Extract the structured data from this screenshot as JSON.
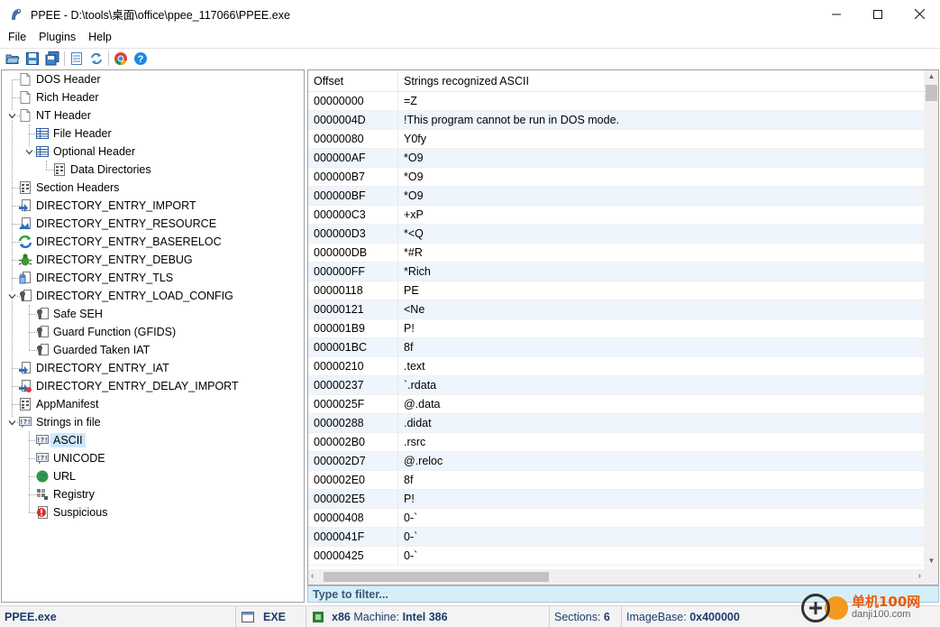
{
  "window": {
    "title": "PPEE - D:\\tools\\桌面\\office\\ppee_117066\\PPEE.exe",
    "minimize": "—",
    "maximize": "☐",
    "close": "✕"
  },
  "menu": [
    "File",
    "Plugins",
    "Help"
  ],
  "toolbar": {
    "buttons": [
      "open-folder",
      "save",
      "save-all",
      "properties",
      "refresh",
      "browser",
      "help"
    ]
  },
  "tree": [
    {
      "label": "DOS Header",
      "icon": "document-icon"
    },
    {
      "label": "Rich Header",
      "icon": "document-icon"
    },
    {
      "label": "NT Header",
      "icon": "document-icon"
    },
    {
      "label": "File Header",
      "icon": "table-icon"
    },
    {
      "label": "Optional Header",
      "icon": "table-icon"
    },
    {
      "label": "Data Directories",
      "icon": "grid-icon"
    },
    {
      "label": "Section Headers",
      "icon": "grid-icon"
    },
    {
      "label": "DIRECTORY_ENTRY_IMPORT",
      "icon": "import-icon"
    },
    {
      "label": "DIRECTORY_ENTRY_RESOURCE",
      "icon": "resource-icon"
    },
    {
      "label": "DIRECTORY_ENTRY_BASERELOC",
      "icon": "reloc-icon"
    },
    {
      "label": "DIRECTORY_ENTRY_DEBUG",
      "icon": "bug-icon"
    },
    {
      "label": "DIRECTORY_ENTRY_TLS",
      "icon": "tls-icon"
    },
    {
      "label": "DIRECTORY_ENTRY_LOAD_CONFIG",
      "icon": "config-icon"
    },
    {
      "label": "Safe SEH",
      "icon": "config-icon"
    },
    {
      "label": "Guard Function (GFIDS)",
      "icon": "config-icon"
    },
    {
      "label": "Guarded Taken IAT",
      "icon": "config-icon"
    },
    {
      "label": "DIRECTORY_ENTRY_IAT",
      "icon": "import-icon"
    },
    {
      "label": "DIRECTORY_ENTRY_DELAY_IMPORT",
      "icon": "delay-import-icon"
    },
    {
      "label": "AppManifest",
      "icon": "grid-icon"
    },
    {
      "label": "Strings in file",
      "icon": "strings-icon"
    },
    {
      "label": "ASCII",
      "icon": "strings-icon"
    },
    {
      "label": "UNICODE",
      "icon": "strings-icon"
    },
    {
      "label": "URL",
      "icon": "globe-icon"
    },
    {
      "label": "Registry",
      "icon": "registry-icon"
    },
    {
      "label": "Suspicious",
      "icon": "warning-icon"
    }
  ],
  "table": {
    "columns": [
      "Offset",
      "Strings recognized ASCII"
    ],
    "rows": [
      [
        "00000000",
        "=Z"
      ],
      [
        "0000004D",
        "!This program cannot be run in DOS mode."
      ],
      [
        "00000080",
        "Y0fy"
      ],
      [
        "000000AF",
        "*O9"
      ],
      [
        "000000B7",
        "*O9"
      ],
      [
        "000000BF",
        "*O9"
      ],
      [
        "000000C3",
        "+xP"
      ],
      [
        "000000D3",
        "*<Q"
      ],
      [
        "000000DB",
        "*#R"
      ],
      [
        "000000FF",
        "*Rich"
      ],
      [
        "00000118",
        "PE"
      ],
      [
        "00000121",
        "<Ne"
      ],
      [
        "000001B9",
        "P!"
      ],
      [
        "000001BC",
        "8f"
      ],
      [
        "00000210",
        ".text"
      ],
      [
        "00000237",
        "`.rdata"
      ],
      [
        "0000025F",
        "@.data"
      ],
      [
        "00000288",
        ".didat"
      ],
      [
        "000002B0",
        ".rsrc"
      ],
      [
        "000002D7",
        "@.reloc"
      ],
      [
        "000002E0",
        "8f"
      ],
      [
        "000002E5",
        "P!"
      ],
      [
        "00000408",
        "0-`"
      ],
      [
        "0000041F",
        "0-`"
      ],
      [
        "00000425",
        "0-`"
      ]
    ]
  },
  "filter": {
    "placeholder": "Type to filter..."
  },
  "status": {
    "filename": "PPEE.exe",
    "type": "EXE",
    "arch": "x86",
    "machine_label": "Machine:",
    "machine": "Intel 386",
    "sections_label": "Sections:",
    "sections": "6",
    "imagebase_label": "ImageBase:",
    "imagebase": "0x400000"
  },
  "watermark": {
    "cn": "单机100网",
    "en": "danji100.com"
  }
}
